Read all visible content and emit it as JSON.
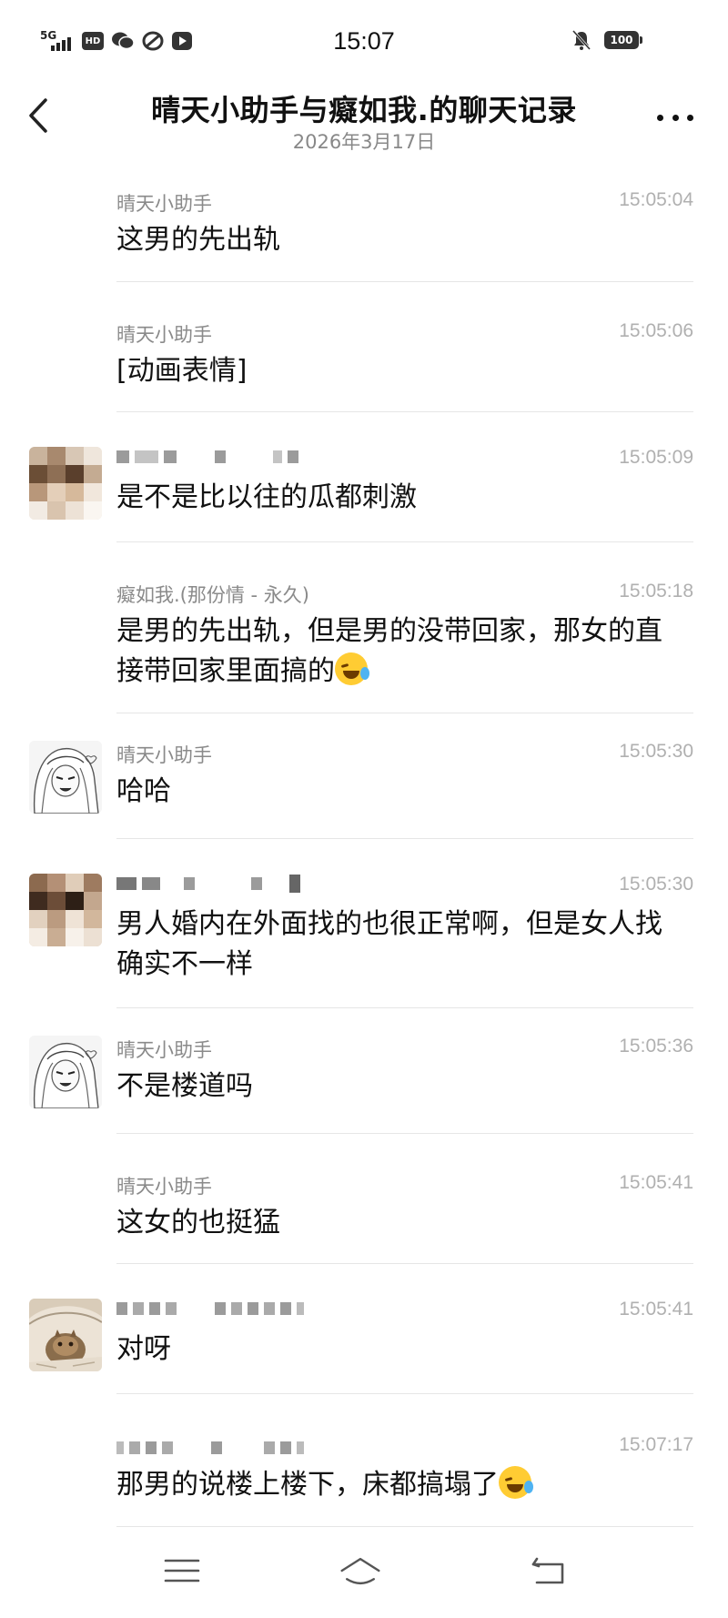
{
  "status_bar": {
    "network": "5G",
    "hd_badge": "HD",
    "time": "15:07",
    "battery": "100",
    "icons": [
      "signal-icon",
      "hd-icon",
      "wechat-icon",
      "sync-icon",
      "video-app-icon",
      "mute-icon",
      "battery-icon"
    ]
  },
  "header": {
    "title": "晴天小助手与癡如我.的聊天记录",
    "date": "2026年3月17日",
    "back_icon": "chevron-left-icon",
    "more_icon": "more-icon"
  },
  "messages": [
    {
      "sender": "晴天小助手",
      "time": "15:05:04",
      "text": "这男的先出轨",
      "avatar": "none"
    },
    {
      "sender": "晴天小助手",
      "time": "15:05:06",
      "text": "[动画表情]",
      "avatar": "none"
    },
    {
      "sender": "",
      "time": "15:05:09",
      "text": "是不是比以往的瓜都刺激",
      "avatar": "pixelated"
    },
    {
      "sender": "癡如我.(那份情 - 永久)",
      "time": "15:05:18",
      "text": "是男的先出轨，但是男的没带回家，那女的直接带回家里面搞的",
      "avatar": "none",
      "emoji": "laughing-crying-emoji"
    },
    {
      "sender": "晴天小助手",
      "time": "15:05:30",
      "text": "哈哈",
      "avatar": "anime-sketch"
    },
    {
      "sender": "",
      "time": "15:05:30",
      "text": "男人婚内在外面找的也很正常啊，但是女人找确实不一样",
      "avatar": "pixelated"
    },
    {
      "sender": "晴天小助手",
      "time": "15:05:36",
      "text": "不是楼道吗",
      "avatar": "anime-sketch"
    },
    {
      "sender": "晴天小助手",
      "time": "15:05:41",
      "text": "这女的也挺猛",
      "avatar": "none"
    },
    {
      "sender": "",
      "time": "15:05:41",
      "text": "对呀",
      "avatar": "cat-photo"
    },
    {
      "sender": "",
      "time": "15:07:17",
      "text": "那男的说楼上楼下，床都搞塌了",
      "avatar": "none",
      "emoji": "laughing-crying-emoji"
    }
  ],
  "navbar": {
    "icons": [
      "menu-icon",
      "home-icon",
      "back-icon"
    ]
  },
  "colors": {
    "background": "#ffffff",
    "text": "#111111",
    "sender": "#8a8a8a",
    "timestamp": "#b0b0b0",
    "divider": "#e6e6e6"
  }
}
